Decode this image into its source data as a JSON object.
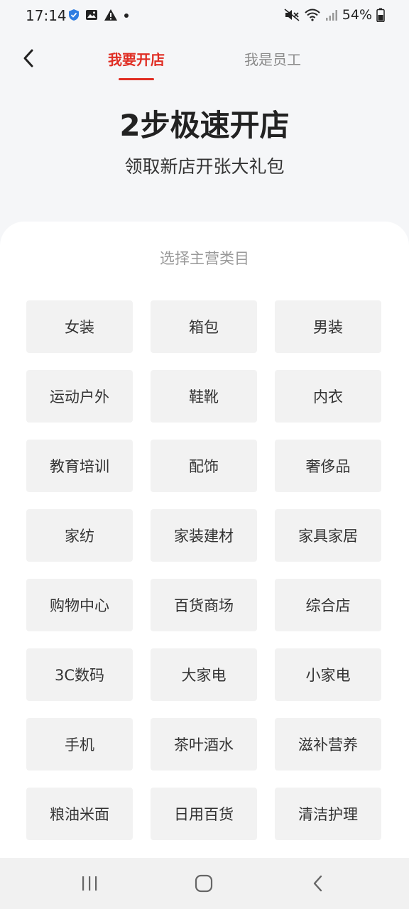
{
  "status_bar": {
    "time": "17:14",
    "battery": "54%"
  },
  "header": {
    "tabs": [
      {
        "label": "我要开店"
      },
      {
        "label": "我是员工"
      }
    ]
  },
  "hero": {
    "title": "2步极速开店",
    "subtitle": "领取新店开张大礼包"
  },
  "panel": {
    "title": "选择主营类目",
    "categories": [
      "女装",
      "箱包",
      "男装",
      "运动户外",
      "鞋靴",
      "内衣",
      "教育培训",
      "配饰",
      "奢侈品",
      "家纺",
      "家装建材",
      "家具家居",
      "购物中心",
      "百货商场",
      "综合店",
      "3C数码",
      "大家电",
      "小家电",
      "手机",
      "茶叶酒水",
      "滋补营养",
      "粮油米面",
      "日用百货",
      "清洁护理"
    ]
  },
  "colors": {
    "accent": "#e02e24",
    "background": "#f5f6f8",
    "card": "#f2f2f2"
  },
  "icons": {
    "back": "chevron-left-icon",
    "nav_recent": "recent-apps-icon",
    "nav_home": "home-icon",
    "nav_back": "back-icon"
  }
}
